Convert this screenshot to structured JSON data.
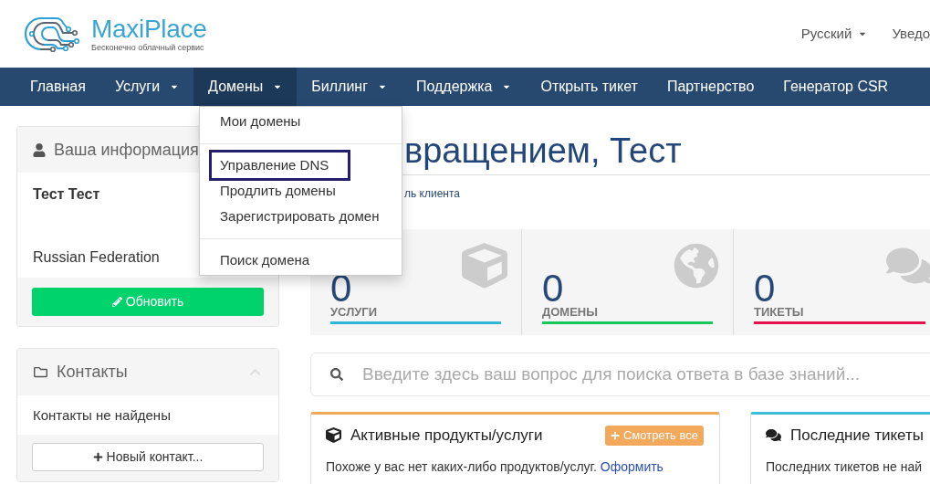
{
  "header": {
    "logo": {
      "name": "MaxiPlace",
      "tagline": "Бесконечно облачный сервис"
    },
    "language": {
      "label": "Русский"
    },
    "notifications": {
      "label": "Уведо"
    }
  },
  "navbar": {
    "items": [
      {
        "label": "Главная",
        "dropdown": false,
        "selected": false
      },
      {
        "label": "Услуги",
        "dropdown": true,
        "selected": false
      },
      {
        "label": "Домены",
        "dropdown": true,
        "selected": true
      },
      {
        "label": "Биллинг",
        "dropdown": true,
        "selected": false
      },
      {
        "label": "Поддержка",
        "dropdown": true,
        "selected": false
      },
      {
        "label": "Открыть тикет",
        "dropdown": false,
        "selected": false
      },
      {
        "label": "Партнерство",
        "dropdown": false,
        "selected": false
      },
      {
        "label": "Генератор CSR",
        "dropdown": false,
        "selected": false
      }
    ]
  },
  "dropdown_menu": {
    "sections": [
      {
        "items": [
          {
            "label": "Мои домены",
            "highlighted": false
          }
        ]
      },
      {
        "items": [
          {
            "label": "Управление DNS",
            "highlighted": true
          },
          {
            "label": "Продлить домены",
            "highlighted": false
          },
          {
            "label": "Зарегистрировать домен",
            "highlighted": false
          }
        ]
      },
      {
        "items": [
          {
            "label": "Поиск домена",
            "highlighted": false
          }
        ]
      }
    ]
  },
  "sidebar": {
    "info_panel": {
      "title": "Ваша информация",
      "name": "Тест Тест",
      "country": "Russian Federation",
      "button": "Обновить"
    },
    "contacts_panel": {
      "title": "Контакты",
      "expanded": true,
      "empty_text": "Контакты не найдены",
      "button": "Новый контакт..."
    }
  },
  "main": {
    "heading": "вращением, Тест",
    "breadcrumb": "ль клиента",
    "stats": [
      {
        "kind": "services",
        "value": "0",
        "label": "УСЛУГИ",
        "color": "#2cb7d6"
      },
      {
        "kind": "domains",
        "value": "0",
        "label": "ДОМЕНЫ",
        "color": "#18c65e"
      },
      {
        "kind": "tickets",
        "value": "0",
        "label": "ТИКЕТЫ",
        "color": "#e5104c"
      }
    ],
    "search": {
      "placeholder": "Введите здесь ваш вопрос для поиска ответа в базе знаний..."
    },
    "cards": [
      {
        "kind": "products",
        "title": "Активные продукты/услуги",
        "color": "#f2a95c",
        "button": "Смотреть все",
        "text": "Похоже у вас нет каких-либо продуктов/услуг.",
        "link": "Оформить"
      },
      {
        "kind": "tickets",
        "title": "Последние тикеты",
        "color": "#3cbfd6",
        "text": "Последних тикетов не най"
      }
    ]
  }
}
